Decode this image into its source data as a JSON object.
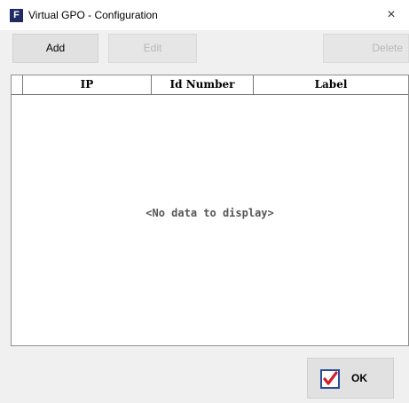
{
  "window": {
    "app_icon_letter": "F",
    "title": "Virtual GPO - Configuration",
    "close_glyph": "×"
  },
  "toolbar": {
    "add_label": "Add",
    "edit_label": "Edit",
    "delete_label": "Delete"
  },
  "grid": {
    "columns": [
      "IP",
      "Id Number",
      "Label"
    ],
    "rows": [],
    "empty_message": "<No data to display>"
  },
  "footer": {
    "ok_label": "OK",
    "ok_icon": "checkbox-check-icon"
  },
  "colors": {
    "app_icon_bg": "#1f2c64",
    "check_red": "#d0202a",
    "check_border": "#2a4a9a"
  }
}
